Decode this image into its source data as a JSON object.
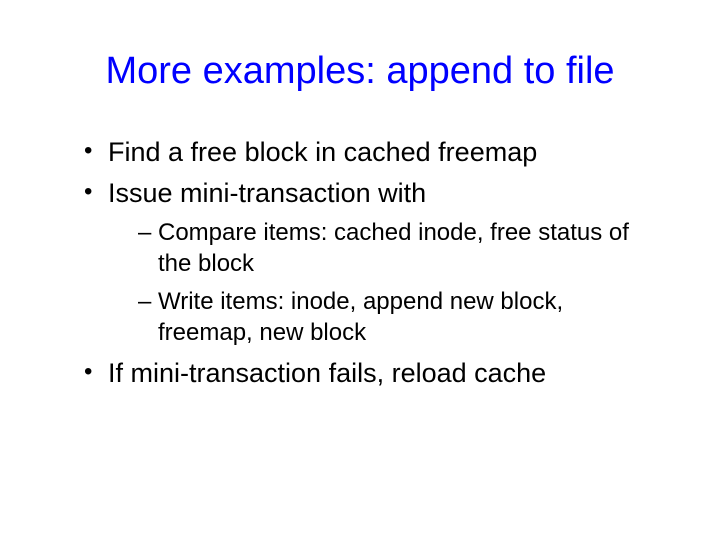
{
  "slide": {
    "title": "More examples: append to file",
    "bullets": [
      {
        "text": "Find a free block in cached freemap"
      },
      {
        "text": "Issue mini-transaction with",
        "sub": [
          {
            "text": "Compare items: cached inode, free status of the block"
          },
          {
            "text": "Write items: inode, append new block, freemap, new block"
          }
        ]
      },
      {
        "text": "If mini-transaction fails, reload cache"
      }
    ]
  }
}
